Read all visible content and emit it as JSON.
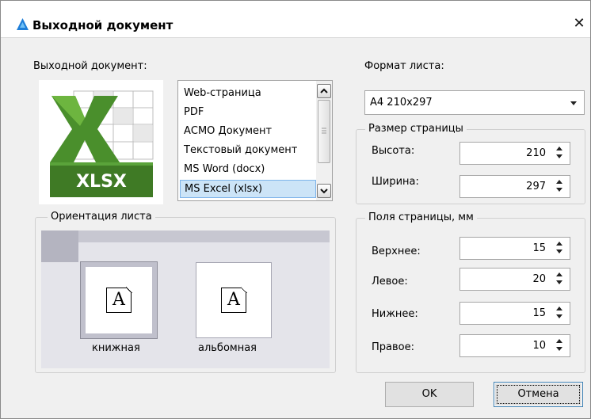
{
  "window": {
    "title": "Выходной документ",
    "close_glyph": "✕",
    "icon": "app-logo-icon",
    "accent": "#1e7ed8"
  },
  "output_doc": {
    "label": "Выходной документ:",
    "icon": "excel-file-icon",
    "icon_text": "XLSX",
    "list_items": [
      "Web-страница",
      "PDF",
      "АСМО Документ",
      "Текстовый документ",
      "MS Word (docx)",
      "MS Excel (xlsx)"
    ],
    "selected_item": "MS Excel (xlsx)"
  },
  "orientation": {
    "legend": "Ориентация листа",
    "portrait_label": "книжная",
    "landscape_label": "альбомная",
    "glyph": "A",
    "selected": "книжная"
  },
  "page_format": {
    "label": "Формат листа:",
    "value": "A4 210x297"
  },
  "page_size": {
    "legend": "Размер страницы",
    "height_label": "Высота:",
    "height_value": "210",
    "width_label": "Ширина:",
    "width_value": "297"
  },
  "margins": {
    "legend": "Поля страницы, мм",
    "top_label": "Верхнее:",
    "top_value": "15",
    "left_label": "Левое:",
    "left_value": "20",
    "bottom_label": "Нижнее:",
    "bottom_value": "15",
    "right_label": "Правое:",
    "right_value": "10"
  },
  "buttons": {
    "ok": "OK",
    "cancel": "Отмена"
  }
}
